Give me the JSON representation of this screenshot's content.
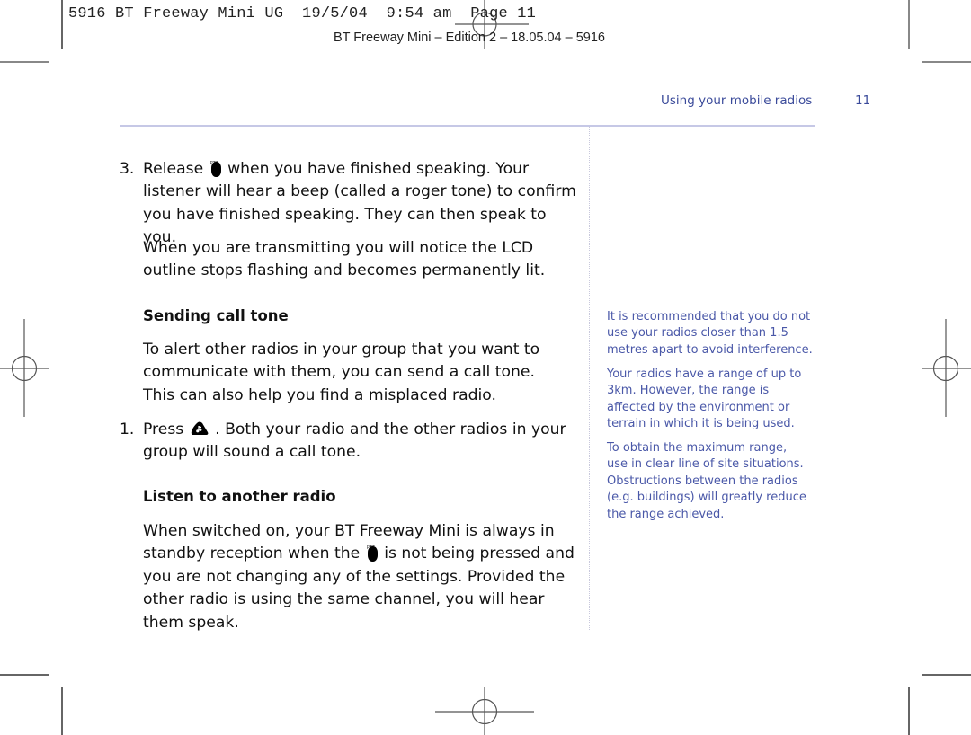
{
  "print_slug": {
    "text": "5916 BT Freeway Mini UG  19/5/04  9:54 am  Page 11",
    "edition": "BT Freeway Mini – Edition 2 – 18.05.04 – 5916"
  },
  "header": {
    "section_title": "Using your mobile radios",
    "page_number": "11",
    "accent_color": "#3a4a9a"
  },
  "main": {
    "step3": {
      "number": "3.",
      "line1_pre": "Release",
      "line1_post": "when you have finished speaking. Your",
      "line2": "listener will hear a beep (called a roger tone) to confirm",
      "line3": "you have finished speaking. They can then speak to you.",
      "icon": "ptt-button-icon",
      "icon_label": "PTT"
    },
    "transmit_note": {
      "line1": "When you are transmitting you will notice the LCD",
      "line2": "outline stops flashing and becomes permanently lit."
    },
    "sending_call_tone": {
      "heading": "Sending call tone",
      "intro_line1": "To alert other radios in your group that you want to",
      "intro_line2": "communicate with them, you can send a call tone.",
      "intro_line3": "This can also help you find a misplaced radio.",
      "step1": {
        "number": "1.",
        "line1_pre": "Press",
        "line1_post": ". Both your radio and the other radios in your",
        "line2": "group will sound a call tone.",
        "icon": "call-tone-button-icon"
      }
    },
    "listen": {
      "heading": "Listen to another radio",
      "line1": "When switched on, your BT Freeway Mini is always in",
      "line2_pre": "standby reception when the",
      "line2_post": "is not being pressed and",
      "line3": "you are not changing any of the settings. Provided the",
      "line4": "other radio is using the same channel, you will hear",
      "line5": "them speak.",
      "icon": "ptt-button-icon",
      "icon_label": "PTT"
    }
  },
  "sidebar": {
    "text_color": "#4a58a8",
    "notes": [
      {
        "lines": [
          "It is recommended that you do not",
          "use your radios closer than 1.5",
          "metres apart to avoid interference."
        ]
      },
      {
        "lines": [
          "Your radios have a range of up to",
          "3km. However, the range is",
          "affected by the environment or",
          "terrain in which it is being used."
        ]
      },
      {
        "lines": [
          "To obtain the maximum range,",
          "use in clear line of site situations.",
          "Obstructions between the radios",
          "(e.g. buildings) will greatly reduce",
          "the range achieved."
        ]
      }
    ]
  }
}
